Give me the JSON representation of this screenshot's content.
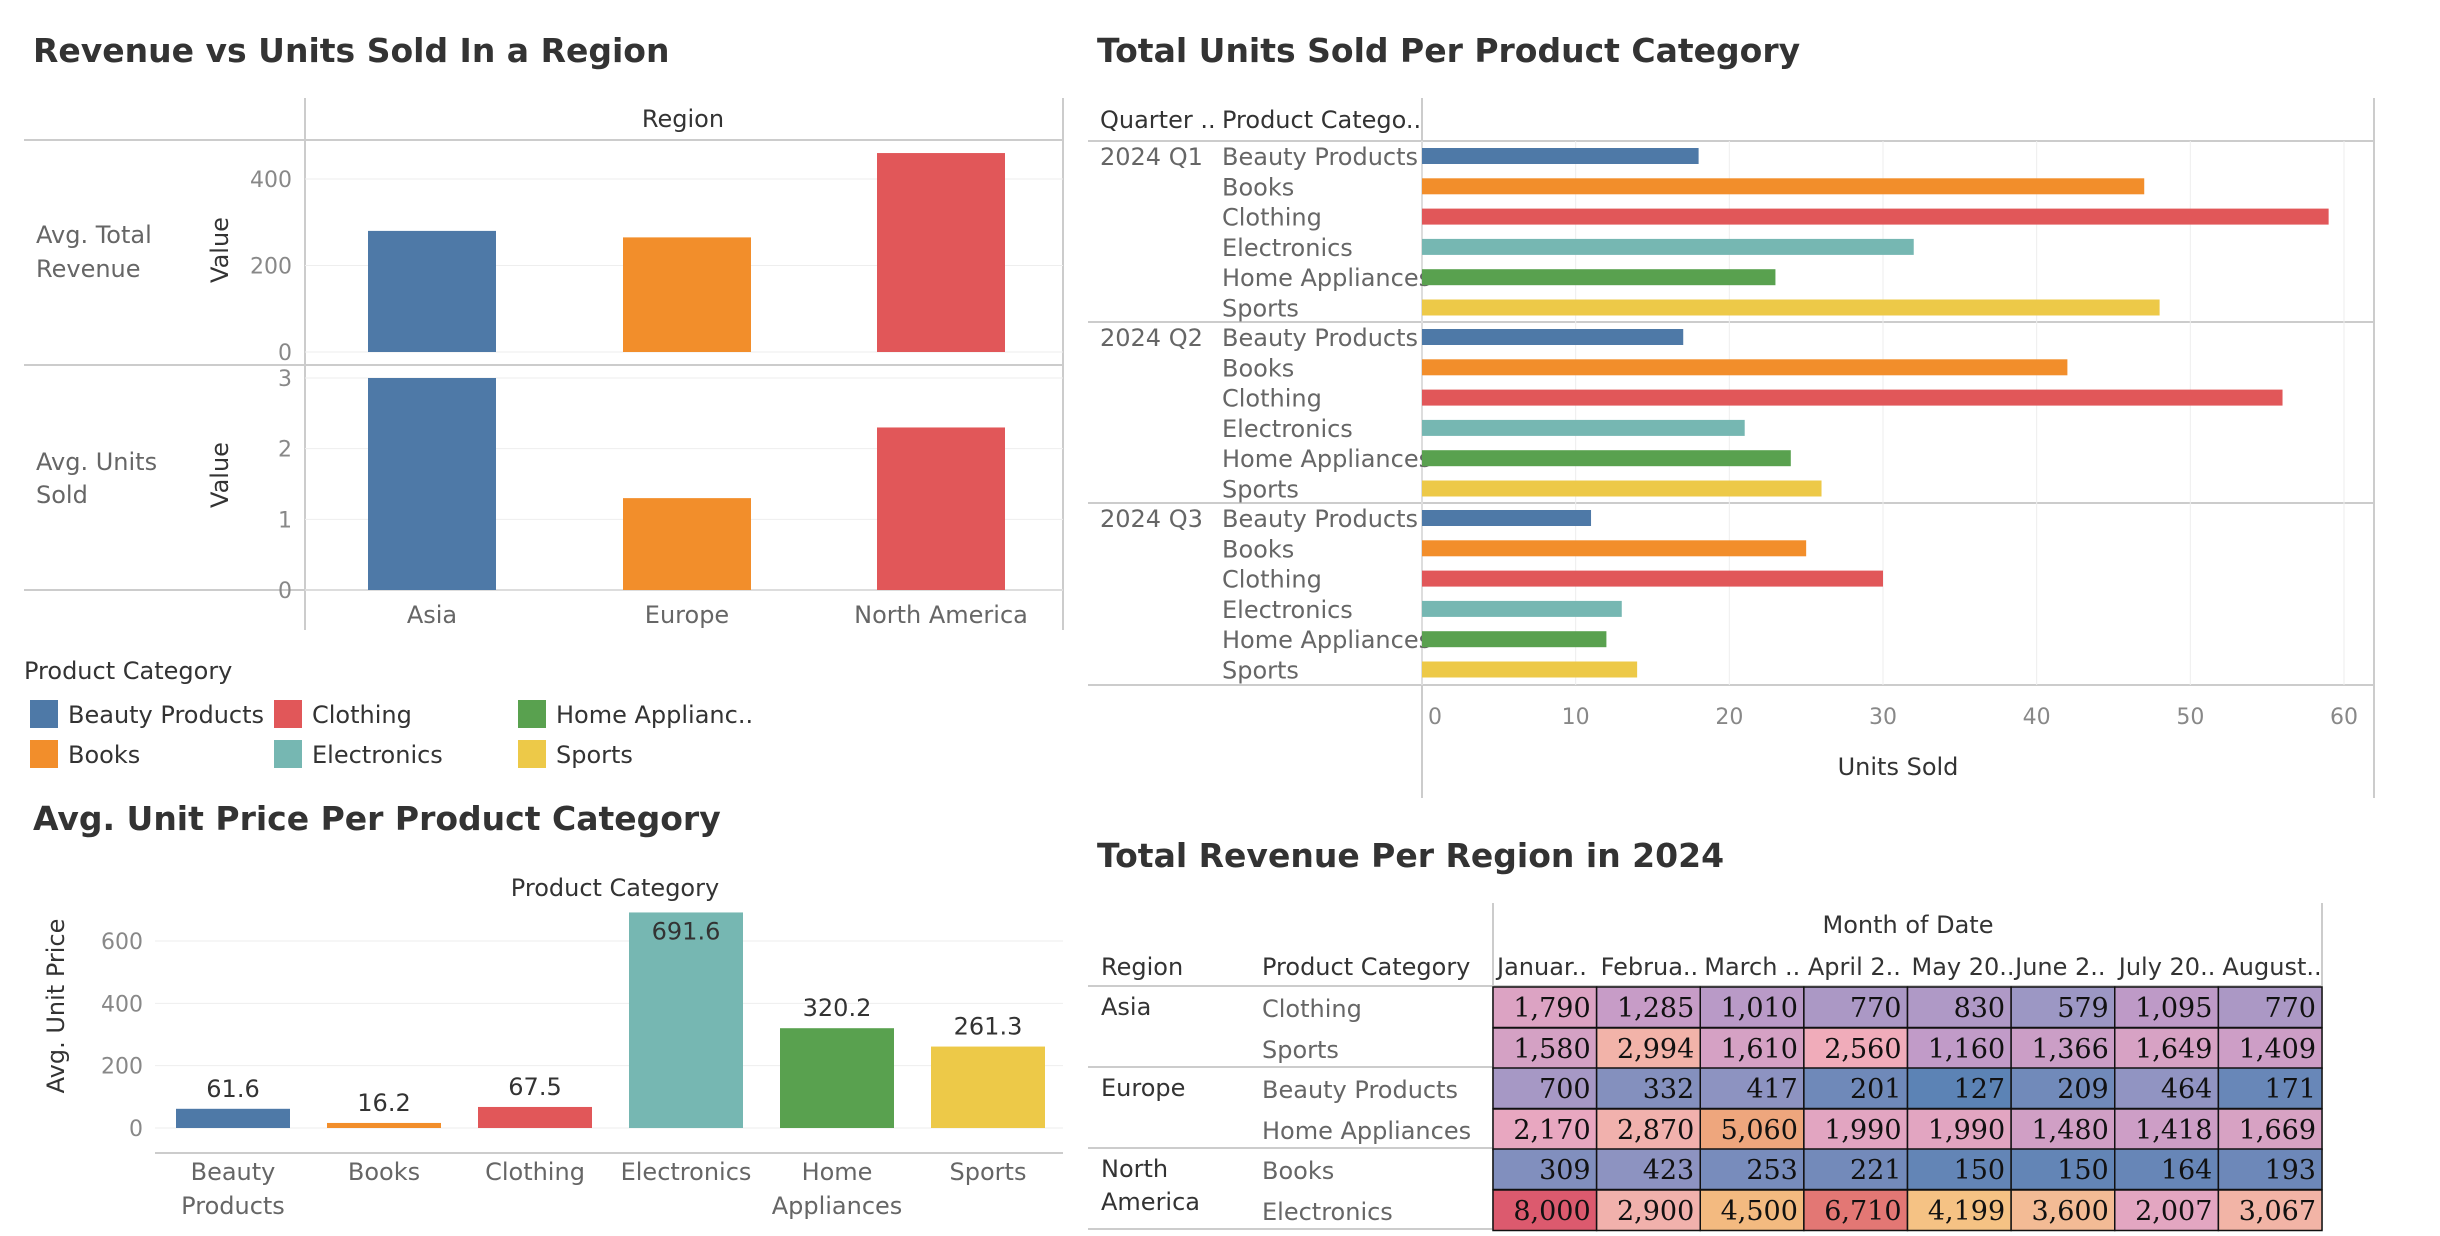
{
  "chart_data": [
    {
      "type": "bar",
      "title": "Revenue vs Units Sold In a Region",
      "column_header": "Region",
      "categories": [
        "Asia",
        "Europe",
        "North America"
      ],
      "colors": [
        "#4e79a7",
        "#f28e2b",
        "#e15759"
      ],
      "panels": [
        {
          "row_label_1": "Avg. Total",
          "row_label_2": "Revenue",
          "axis_label": "Value",
          "values": [
            280,
            265,
            460
          ],
          "ylim": [
            0,
            470
          ],
          "ticks": [
            "0",
            "200",
            "400"
          ],
          "tick_values": [
            0,
            200,
            400
          ]
        },
        {
          "row_label_1": "Avg. Units",
          "row_label_2": "Sold",
          "axis_label": "Value",
          "values": [
            3.0,
            1.3,
            2.3
          ],
          "ylim": [
            0,
            3.1
          ],
          "ticks": [
            "0",
            "1",
            "2",
            "3"
          ],
          "tick_values": [
            0,
            1,
            2,
            3
          ]
        }
      ]
    },
    {
      "type": "bar",
      "orientation": "horizontal",
      "title": "Total Units Sold Per Product Category",
      "header_quarter": "Quarter ..",
      "header_category": "Product Catego..",
      "xlabel": "Units Sold",
      "xlim": [
        0,
        62
      ],
      "ticks": [
        "0",
        "10",
        "20",
        "30",
        "40",
        "50",
        "60"
      ],
      "tick_values": [
        0,
        10,
        20,
        30,
        40,
        50,
        60
      ],
      "groups": [
        {
          "quarter": "2024 Q1",
          "items": [
            {
              "category": "Beauty Products",
              "value": 18
            },
            {
              "category": "Books",
              "value": 47
            },
            {
              "category": "Clothing",
              "value": 59
            },
            {
              "category": "Electronics",
              "value": 32
            },
            {
              "category": "Home Appliances",
              "value": 23
            },
            {
              "category": "Sports",
              "value": 48
            }
          ]
        },
        {
          "quarter": "2024 Q2",
          "items": [
            {
              "category": "Beauty Products",
              "value": 17
            },
            {
              "category": "Books",
              "value": 42
            },
            {
              "category": "Clothing",
              "value": 56
            },
            {
              "category": "Electronics",
              "value": 21
            },
            {
              "category": "Home Appliances",
              "value": 24
            },
            {
              "category": "Sports",
              "value": 26
            }
          ]
        },
        {
          "quarter": "2024 Q3",
          "items": [
            {
              "category": "Beauty Products",
              "value": 11
            },
            {
              "category": "Books",
              "value": 25
            },
            {
              "category": "Clothing",
              "value": 30
            },
            {
              "category": "Electronics",
              "value": 13
            },
            {
              "category": "Home Appliances",
              "value": 12
            },
            {
              "category": "Sports",
              "value": 14
            }
          ]
        }
      ]
    },
    {
      "type": "bar",
      "title": "Avg. Unit Price Per Product Category",
      "column_header": "Product Category",
      "ylabel": "Avg. Unit Price",
      "ylim": [
        0,
        700
      ],
      "ticks": [
        "0",
        "200",
        "400",
        "600"
      ],
      "tick_values": [
        0,
        200,
        400,
        600
      ],
      "categories": [
        [
          "Beauty",
          "Products"
        ],
        [
          "Books"
        ],
        [
          "Clothing"
        ],
        [
          "Electronics"
        ],
        [
          "Home",
          "Appliances"
        ],
        [
          "Sports"
        ]
      ],
      "values": [
        61.6,
        16.2,
        67.5,
        691.6,
        320.2,
        261.3
      ],
      "value_labels": [
        "61.6",
        "16.2",
        "67.5",
        "691.6",
        "320.2",
        "261.3"
      ],
      "colors": [
        "#4e79a7",
        "#f28e2b",
        "#e15759",
        "#76b7b2",
        "#59a14f",
        "#edc948"
      ]
    },
    {
      "type": "table",
      "title": "Total Revenue Per Region in 2024",
      "column_header": "Month of Date",
      "header_region": "Region",
      "header_category": "Product Category",
      "months": [
        "Januar..",
        "Februa..",
        "March ..",
        "April 2..",
        "May 20..",
        "June 2..",
        "July 20..",
        "August.."
      ],
      "rows": [
        {
          "region_1": "Asia",
          "region_2": "",
          "category": "Clothing",
          "values": [
            1790,
            1285,
            1010,
            770,
            830,
            579,
            1095,
            770
          ],
          "labels": [
            "1,790",
            "1,285",
            "1,010",
            "770",
            "830",
            "579",
            "1,095",
            "770"
          ]
        },
        {
          "region_1": "",
          "region_2": "",
          "category": "Sports",
          "values": [
            1580,
            2994,
            1610,
            2560,
            1160,
            1366,
            1649,
            1409
          ],
          "labels": [
            "1,580",
            "2,994",
            "1,610",
            "2,560",
            "1,160",
            "1,366",
            "1,649",
            "1,409"
          ]
        },
        {
          "region_1": "Europe",
          "region_2": "",
          "category": "Beauty Products",
          "values": [
            700,
            332,
            417,
            201,
            127,
            209,
            464,
            171
          ],
          "labels": [
            "700",
            "332",
            "417",
            "201",
            "127",
            "209",
            "464",
            "171"
          ]
        },
        {
          "region_1": "",
          "region_2": "",
          "category": "Home Appliances",
          "values": [
            2170,
            2870,
            5060,
            1990,
            1990,
            1480,
            1418,
            1669
          ],
          "labels": [
            "2,170",
            "2,870",
            "5,060",
            "1,990",
            "1,990",
            "1,480",
            "1,418",
            "1,669"
          ]
        },
        {
          "region_1": "North",
          "region_2": "America",
          "category": "Books",
          "values": [
            309,
            423,
            253,
            221,
            150,
            150,
            164,
            193
          ],
          "labels": [
            "309",
            "423",
            "253",
            "221",
            "150",
            "150",
            "164",
            "193"
          ]
        },
        {
          "region_1": "",
          "region_2": "",
          "category": "Electronics",
          "values": [
            8000,
            2900,
            4500,
            6710,
            4199,
            3600,
            2007,
            3067
          ],
          "labels": [
            "8,000",
            "2,900",
            "4,500",
            "6,710",
            "4,199",
            "3,600",
            "2,007",
            "3,067"
          ]
        }
      ]
    }
  ],
  "legend": {
    "title": "Product Category",
    "items": [
      {
        "label": "Beauty Products",
        "color": "#4e79a7"
      },
      {
        "label": "Books",
        "color": "#f28e2b"
      },
      {
        "label": "Clothing",
        "color": "#e15759"
      },
      {
        "label": "Electronics",
        "color": "#76b7b2"
      },
      {
        "label": "Home Applianc..",
        "color": "#59a14f"
      },
      {
        "label": "Sports",
        "color": "#edc948"
      }
    ]
  },
  "category_colors": {
    "Beauty Products": "#4e79a7",
    "Books": "#f28e2b",
    "Clothing": "#e15759",
    "Electronics": "#76b7b2",
    "Home Appliances": "#59a14f",
    "Sports": "#edc948"
  }
}
